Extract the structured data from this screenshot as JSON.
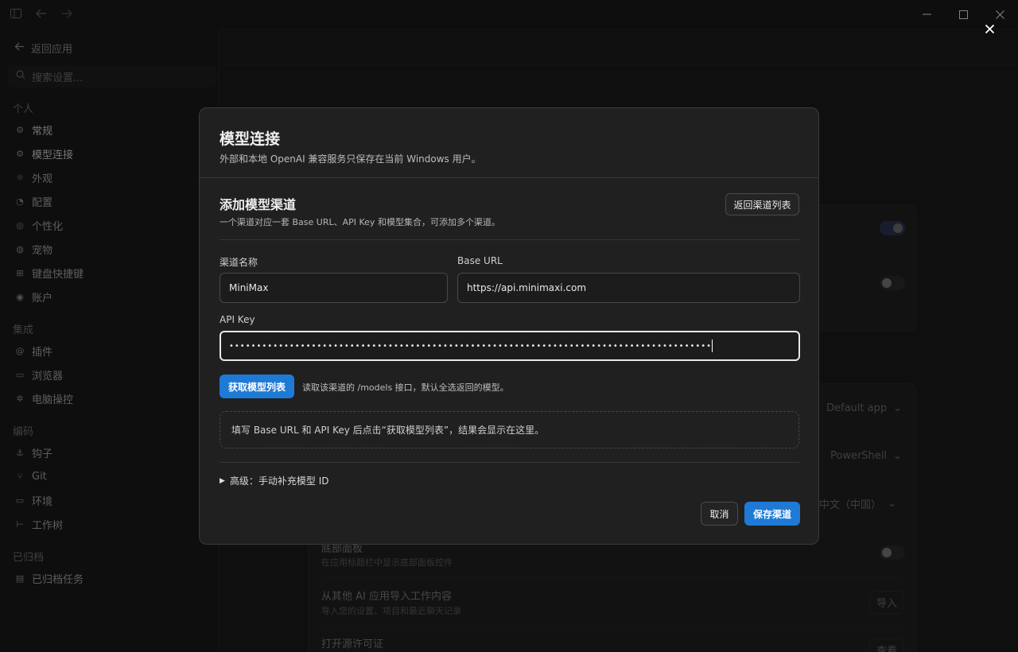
{
  "titlebar": {
    "sidebar_toggle_icon": "sidebar-icon",
    "back_icon": "arrow-left-icon",
    "forward_icon": "arrow-right-icon",
    "minimize_glyph": "—",
    "maximize_glyph": "☐",
    "close_glyph": "✕"
  },
  "sidebar": {
    "back_label": "返回应用",
    "search_placeholder": "搜索设置...",
    "groups": [
      {
        "title": "个人",
        "items": [
          "常规",
          "模型连接",
          "外观",
          "配置",
          "个性化",
          "宠物",
          "键盘快捷键",
          "账户"
        ]
      },
      {
        "title": "集成",
        "items": [
          "插件",
          "浏览器",
          "电脑操控"
        ]
      },
      {
        "title": "编码",
        "items": [
          "钩子",
          "Git",
          "环境",
          "工作树"
        ]
      },
      {
        "title": "已归档",
        "items": [
          "已归档任务"
        ]
      }
    ]
  },
  "background": {
    "select_open_with": "Default app",
    "select_terminal": "PowerShell",
    "select_language": "中文（中国）",
    "row_bottom_panel_title": "底部面板",
    "row_bottom_panel_sub": "在应用标题栏中显示底部面板控件",
    "row_import_title": "从其他 AI 应用导入工作内容",
    "row_import_sub": "导入您的设置、项目和最近聊天记录",
    "row_import_button": "导入",
    "row_license_title": "打开源许可证",
    "row_license_button": "查看"
  },
  "overlay": {
    "close_glyph": "✕"
  },
  "modal": {
    "title": "模型连接",
    "subtitle": "外部和本地 OpenAI 兼容服务只保存在当前 Windows 用户。",
    "section_title": "添加模型渠道",
    "section_subtitle": "一个渠道对应一套 Base URL、API Key 和模型集合，可添加多个渠道。",
    "back_to_list": "返回渠道列表",
    "channel_name_label": "渠道名称",
    "channel_name_value": "MiniMax",
    "base_url_label": "Base URL",
    "base_url_value": "https://api.minimaxi.com",
    "api_key_label": "API Key",
    "api_key_masked": "••••••••••••••••••••••••••••••••••••••••••••••••••••••••••••••••••••••••••••••••••••••••••••••••••••••••••",
    "fetch_button": "获取模型列表",
    "fetch_hint": "读取该渠道的 /models 接口，默认全选返回的模型。",
    "result_placeholder": "填写 Base URL 和 API Key 后点击“获取模型列表”，结果会显示在这里。",
    "advanced_label": "高级：手动补充模型 ID",
    "cancel_button": "取消",
    "save_button": "保存渠道"
  }
}
